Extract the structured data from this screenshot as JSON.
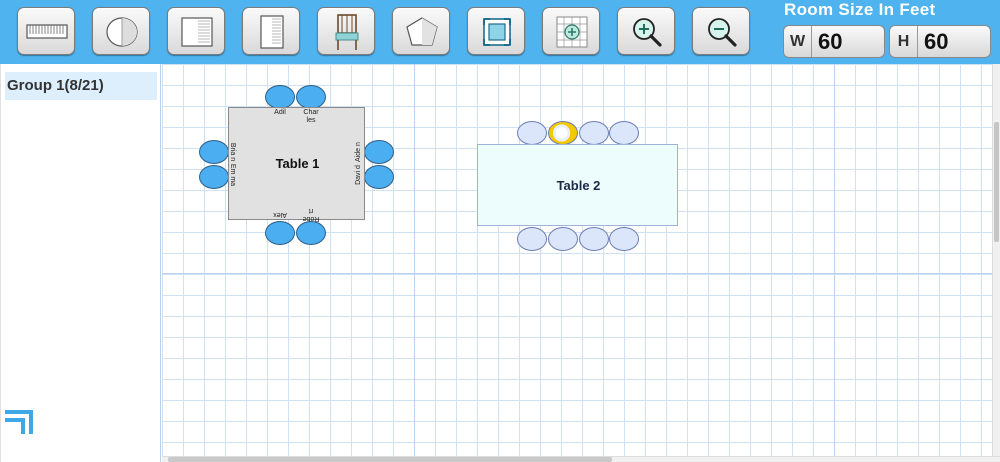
{
  "toolbar": {
    "tools": [
      {
        "name": "wall",
        "icon": "wall-ruler-icon"
      },
      {
        "name": "round-table",
        "icon": "round-table-icon"
      },
      {
        "name": "square-table",
        "icon": "square-table-icon"
      },
      {
        "name": "rect-table",
        "icon": "rect-table-icon"
      },
      {
        "name": "chair",
        "icon": "chair-icon"
      },
      {
        "name": "pentagon",
        "icon": "pentagon-shape-icon"
      },
      {
        "name": "fit",
        "icon": "fit-to-screen-icon"
      },
      {
        "name": "grid-add",
        "icon": "grid-add-icon"
      },
      {
        "name": "zoom-in",
        "icon": "zoom-in-icon"
      },
      {
        "name": "zoom-out",
        "icon": "zoom-out-icon"
      }
    ],
    "room_title": "Room Size In Feet",
    "width_label": "W",
    "width_value": "60",
    "height_label": "H",
    "height_value": "60"
  },
  "sidebar": {
    "group_label": "Group 1(8/21)"
  },
  "colors": {
    "toolbar_bg": "#4eb3ee",
    "seat_assigned": "#4aaef0",
    "seat_empty": "#dbe6fb",
    "seat_selected": "#f5c800",
    "grid_line": "#cfe2f5"
  },
  "tables": [
    {
      "label": "Table 1",
      "guests": [
        "Adil",
        "Char les",
        "Bria n",
        "Em ma",
        "Aide n",
        "Davi d",
        "Alex",
        "Robe rt"
      ]
    },
    {
      "label": "Table 2",
      "guests": []
    }
  ]
}
